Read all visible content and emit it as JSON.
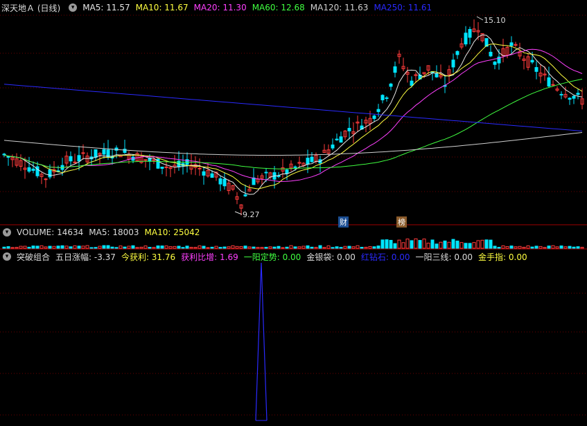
{
  "main": {
    "title": "深天地Ａ (日线)",
    "indicators": [
      {
        "label": "MA5: 11.57",
        "color": "#e8e8e8"
      },
      {
        "label": "MA10: 11.67",
        "color": "#ffff40"
      },
      {
        "label": "MA20: 11.30",
        "color": "#ff40ff"
      },
      {
        "label": "MA60: 12.68",
        "color": "#40ff40"
      },
      {
        "label": "MA120: 11.63",
        "color": "#d0d0d0"
      },
      {
        "label": "MA250: 11.61",
        "color": "#2a2aff"
      }
    ],
    "high_label": "15.10",
    "low_label": "9.27",
    "markers": [
      {
        "text": "财",
        "bg": "#1b4d91",
        "fg": "#fff"
      },
      {
        "text": "榜",
        "bg": "#8a5a2a",
        "fg": "#fff"
      }
    ]
  },
  "volume": {
    "label": "VOLUME: 14634",
    "ma5": "MA5: 18003",
    "ma10": "MA10: 25042"
  },
  "indicator": {
    "name": "突破组合",
    "items": [
      {
        "label": "五日涨幅: -3.37",
        "color": "#dcdcdc"
      },
      {
        "label": "今获利: 31.76",
        "color": "#ffff40"
      },
      {
        "label": "获利比增: 1.69",
        "color": "#ff40ff"
      },
      {
        "label": "一阳定势: 0.00",
        "color": "#40ff40"
      },
      {
        "label": "金银袋: 0.00",
        "color": "#dcdcdc"
      },
      {
        "label": "红钻石: 0.00",
        "color": "#2a2aff"
      },
      {
        "label": "一阳三线: 0.00",
        "color": "#dcdcdc"
      },
      {
        "label": "金手指: 0.00",
        "color": "#ffff40"
      }
    ]
  },
  "colors": {
    "up": "#ff3b3b",
    "down": "#00e5ff",
    "grid": "#6e0000",
    "axis": "#a00000"
  }
}
